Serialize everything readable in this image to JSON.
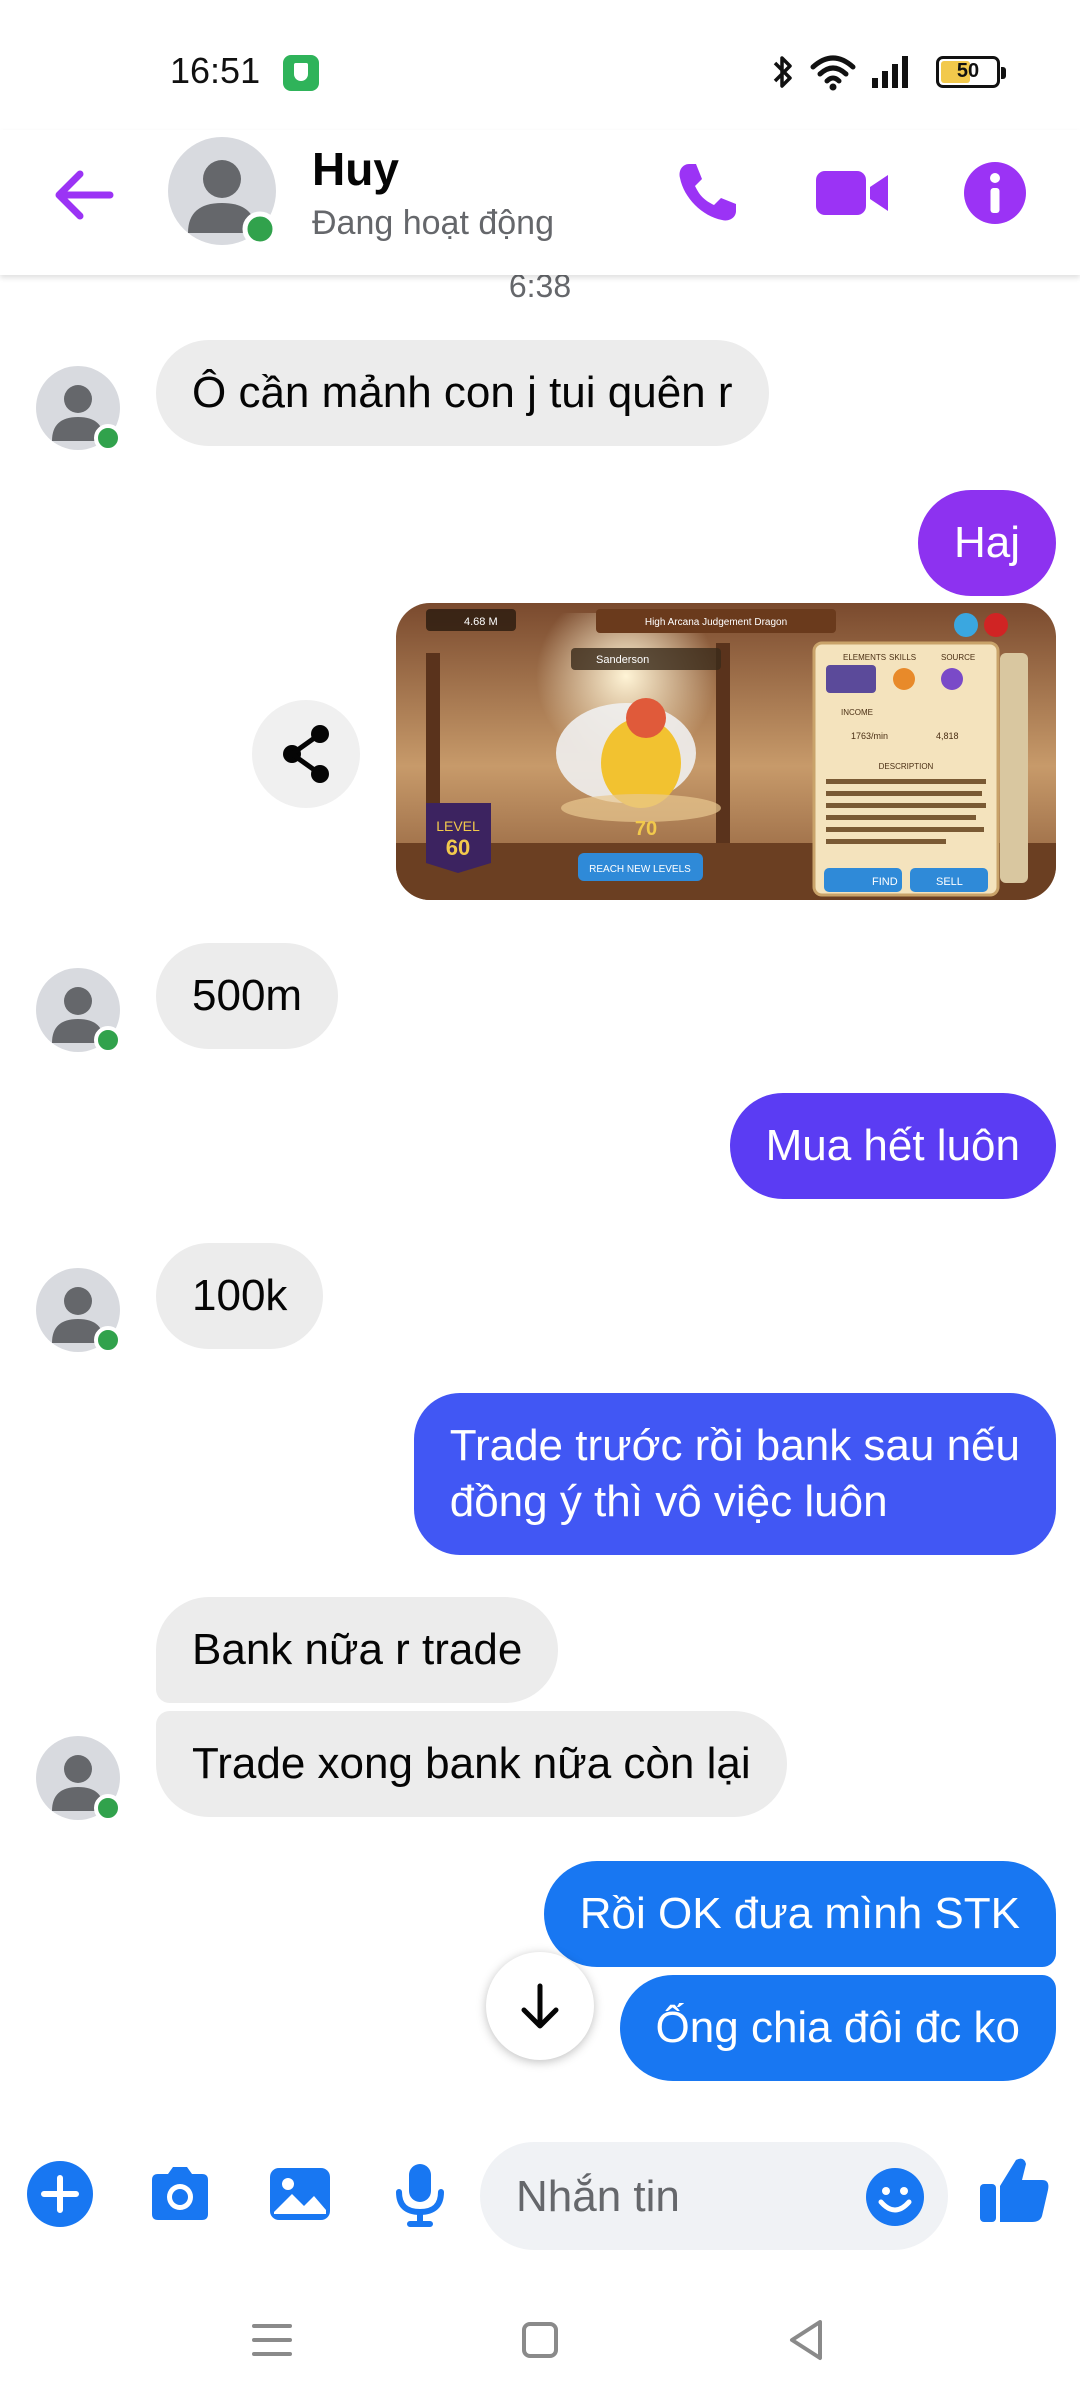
{
  "status_bar": {
    "time": "16:51",
    "battery_level": "50",
    "icons": [
      "shield-icon",
      "bluetooth-icon",
      "wifi-icon",
      "signal-icon",
      "battery-icon"
    ]
  },
  "header": {
    "contact_name": "Huy",
    "contact_status": "Đang hoạt động",
    "icons": [
      "back-arrow-icon",
      "phone-icon",
      "video-camera-icon",
      "info-icon"
    ]
  },
  "chat": {
    "timestamp": "6:38",
    "messages": [
      {
        "direction": "incoming",
        "text": "Ô cần mảnh con j tui quên r"
      },
      {
        "direction": "outgoing",
        "text": "Haj"
      },
      {
        "direction": "outgoing",
        "type": "image",
        "caption": "Game screenshot of High Arcana Judgement Dragon"
      },
      {
        "direction": "incoming",
        "text": "500m"
      },
      {
        "direction": "outgoing",
        "text": "Mua hết luôn"
      },
      {
        "direction": "incoming",
        "text": "100k"
      },
      {
        "direction": "outgoing",
        "text": "Trade trước rồi bank sau nếu",
        "text_line2": "đồng ý thì vô việc luôn"
      },
      {
        "direction": "incoming",
        "text": "Bank nữa r trade"
      },
      {
        "direction": "incoming",
        "text": "Trade xong bank nữa còn lại"
      },
      {
        "direction": "outgoing",
        "text": "Rồi OK đưa mình STK"
      },
      {
        "direction": "outgoing",
        "text": "Ống chia đôi đc ko"
      }
    ]
  },
  "game_image": {
    "title": "High Arcana Judgement Dragon",
    "gold": "4.68 M",
    "name_field": "Sanderson",
    "tabs": [
      "ELEMENTS",
      "SKILLS",
      "SOURCE"
    ],
    "income_label": "INCOME",
    "income_value": "1763/min",
    "sell_value": "4,818",
    "level_label": "LEVEL",
    "level_value": "60",
    "stars_count": "70",
    "reach_button": "REACH NEW LEVELS",
    "description_label": "DESCRIPTION",
    "description": "Number 20, better known as the High Arcana Judgement Dragon, holds ALL creatures to a high standard of morality - even the darkest secrets of the most holy dragons will eventually be uncovered. The High Master Karma Dragon has quite a few missed calls from the Ace of Arcana...",
    "find_button": "FIND",
    "sell_button": "SELL"
  },
  "composer": {
    "placeholder": "Nhắn tin",
    "icons": [
      "plus-icon",
      "camera-icon",
      "gallery-icon",
      "microphone-icon",
      "emoji-icon",
      "thumbs-up-icon"
    ]
  },
  "colors": {
    "accent": "#9b33f5",
    "bubble_purple": "#8d32f0",
    "bubble_indigo": "#5b3cf3",
    "bubble_blue": "#4157f4",
    "bubble_bright_blue": "#1877f2",
    "incoming_bubble": "#ececec",
    "online": "#31a24c"
  }
}
